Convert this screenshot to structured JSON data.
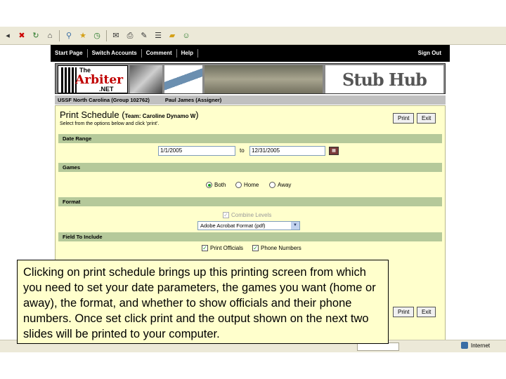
{
  "browser": {
    "toolbar_icons": [
      "back-icon",
      "close-icon",
      "refresh-icon",
      "home-icon",
      "search-icon",
      "favorites-icon",
      "history-icon",
      "mail-icon",
      "print-icon",
      "edit-icon",
      "discuss-icon",
      "folder-icon",
      "messenger-icon"
    ],
    "status_zone": "Internet"
  },
  "nav": {
    "start_page": "Start Page",
    "switch_accounts": "Switch Accounts",
    "comment": "Comment",
    "help": "Help",
    "sign_out": "Sign Out"
  },
  "banner": {
    "logo_the": "The",
    "logo_name": "Arbiter",
    "logo_net": ".NET",
    "sponsor": "Stub Hub"
  },
  "infobar": {
    "organization": "USSF North Carolina (Group 102762)",
    "user": "Paul James (Assigner)"
  },
  "print_schedule": {
    "title": "Print Schedule",
    "team_prefix": "(",
    "team": "Team: Caroline Dynamo W",
    "team_suffix": ")",
    "subtitle": "Select from the options below and click 'print'.",
    "print_button": "Print",
    "exit_button": "Exit",
    "date_range_label": "Date Range",
    "start_date": "1/1/2005",
    "to_label": "to",
    "end_date": "12/31/2005",
    "games_label": "Games",
    "opt_both": "Both",
    "opt_home": "Home",
    "opt_away": "Away",
    "selected_games": "Both",
    "format_label": "Format",
    "combine_levels": "Combine Levels",
    "format_value": "Adobe Acrobat Format (pdf)",
    "fields_label": "Field To Include",
    "print_officials": "Print Officials",
    "phone_numbers": "Phone Numbers"
  },
  "callout": {
    "text": "Clicking on print schedule brings up this printing screen from which you need to set your date parameters, the games you want (home or away), the format, and whether to show officials and their phone numbers.  Once set click print and the output shown on the next two slides will be printed to your computer."
  }
}
